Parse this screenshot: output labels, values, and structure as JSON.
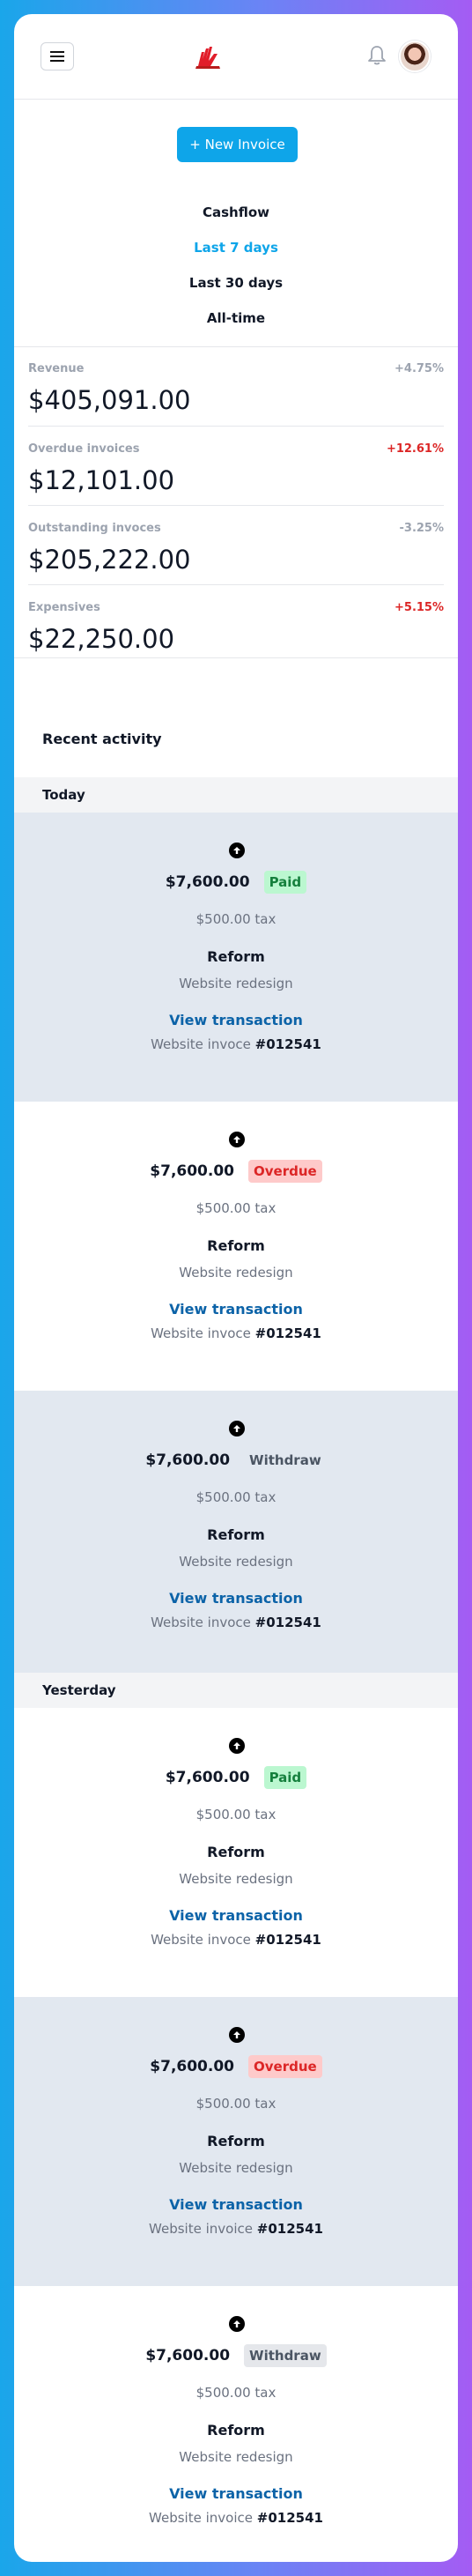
{
  "header": {
    "menu_icon": "hamburger-icon",
    "logo": "brand-logo",
    "notification_icon": "bell-icon",
    "avatar": "user-avatar"
  },
  "actions": {
    "new_invoice_label": "+ New Invoice"
  },
  "ranges": {
    "items": [
      "Cashflow",
      "Last 7 days",
      "Last 30 days",
      "All-time"
    ],
    "active_index": 1
  },
  "stats": [
    {
      "label": "Revenue",
      "change": "+4.75%",
      "change_color": "#9ca3af",
      "value": "$405,091.00"
    },
    {
      "label": "Overdue invoices",
      "change": "+12.61%",
      "change_color": "#dc2626",
      "value": "$12,101.00"
    },
    {
      "label": "Outstanding invoces",
      "change": "-3.25%",
      "change_color": "#9ca3af",
      "value": "$205,222.00"
    },
    {
      "label": "Expensives",
      "change": "+5.15%",
      "change_color": "#dc2626",
      "value": "$22,250.00"
    }
  ],
  "recent": {
    "title": "Recent activity",
    "groups": [
      {
        "day": "Today",
        "items": [
          {
            "amount": "$7,600.00",
            "status": "Paid",
            "status_type": "paid",
            "tax": "$500.00 tax",
            "client": "Reform",
            "project": "Website redesign",
            "link": "View transaction",
            "invoice_prefix": "Website invoce",
            "invoice_number": "#012541"
          },
          {
            "amount": "$7,600.00",
            "status": "Overdue",
            "status_type": "overdue",
            "tax": "$500.00 tax",
            "client": "Reform",
            "project": "Website redesign",
            "link": "View transaction",
            "invoice_prefix": "Website invoce",
            "invoice_number": "#012541"
          },
          {
            "amount": "$7,600.00",
            "status": "Withdraw",
            "status_type": "withdraw",
            "tax": "$500.00 tax",
            "client": "Reform",
            "project": "Website redesign",
            "link": "View transaction",
            "invoice_prefix": "Website invoce",
            "invoice_number": "#012541"
          }
        ]
      },
      {
        "day": "Yesterday",
        "items": [
          {
            "amount": "$7,600.00",
            "status": "Paid",
            "status_type": "paid",
            "tax": "$500.00 tax",
            "client": "Reform",
            "project": "Website redesign",
            "link": "View transaction",
            "invoice_prefix": "Website invoce",
            "invoice_number": "#012541"
          },
          {
            "amount": "$7,600.00",
            "status": "Overdue",
            "status_type": "overdue",
            "tax": "$500.00 tax",
            "client": "Reform",
            "project": "Website redesign",
            "link": "View transaction",
            "invoice_prefix": "Website invoice",
            "invoice_number": "#012541"
          },
          {
            "amount": "$7,600.00",
            "status": "Withdraw",
            "status_type": "withdraw",
            "tax": "$500.00 tax",
            "client": "Reform",
            "project": "Website redesign",
            "link": "View transaction",
            "invoice_prefix": "Website invoice",
            "invoice_number": "#012541"
          }
        ]
      }
    ]
  },
  "colors": {
    "accent": "#0ea5e9",
    "link": "#0c63a8",
    "negative": "#dc2626",
    "paid_bg": "#bbf7d0",
    "overdue_bg": "#fecaca",
    "shaded_row": "#e2e8f0"
  }
}
